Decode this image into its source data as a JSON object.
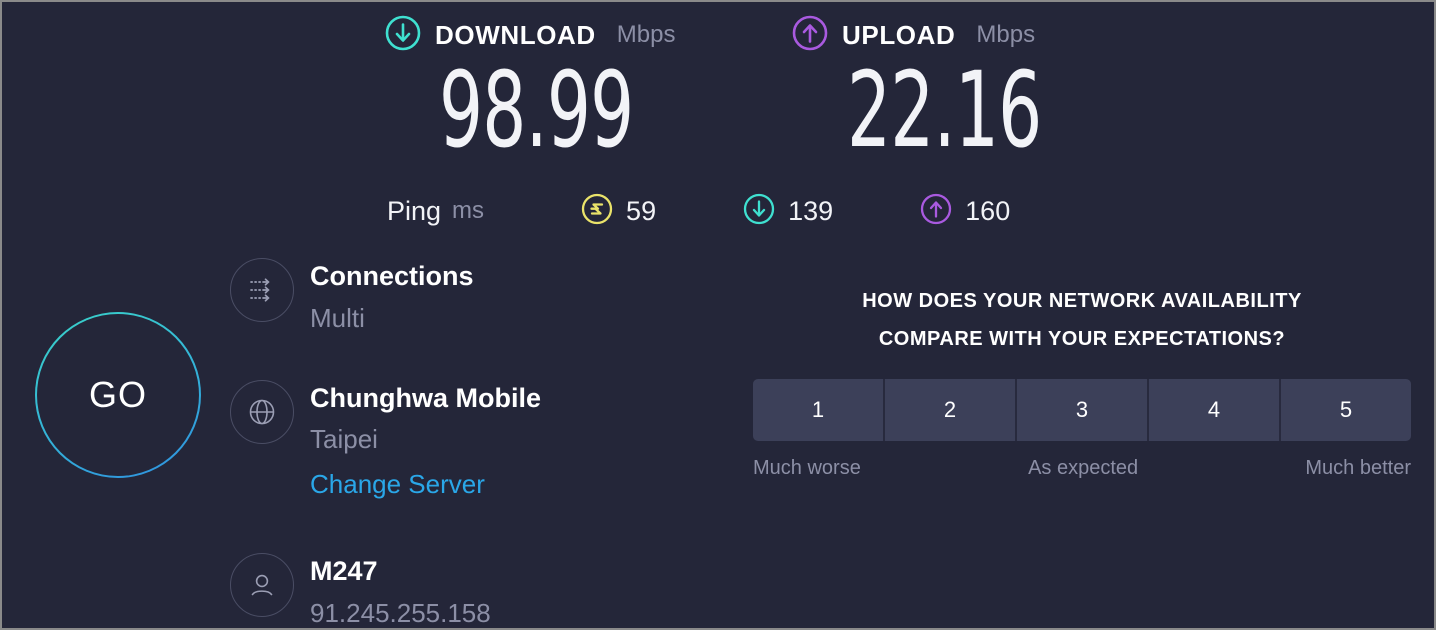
{
  "theme": {
    "background": "#242639",
    "download_accent": "#3fe0d0",
    "upload_accent": "#a95ae0",
    "idle_ping_accent": "#eae36a",
    "link_color": "#2aa7e8",
    "muted_text": "#8c8fa6",
    "rating_button_bg": "#3c4059"
  },
  "results": {
    "download": {
      "icon": "download-arrow-icon",
      "label": "DOWNLOAD",
      "unit": "Mbps",
      "value": "98.99"
    },
    "upload": {
      "icon": "upload-arrow-icon",
      "label": "UPLOAD",
      "unit": "Mbps",
      "value": "22.16"
    },
    "ping": {
      "label": "Ping",
      "unit": "ms",
      "idle": {
        "icon": "idle-ping-icon",
        "value": "59"
      },
      "download": {
        "icon": "download-ping-icon",
        "value": "139"
      },
      "upload": {
        "icon": "upload-ping-icon",
        "value": "160"
      }
    }
  },
  "go_button": {
    "label": "GO"
  },
  "connection_info": {
    "connections": {
      "icon": "multi-connections-icon",
      "title": "Connections",
      "subtitle": "Multi"
    },
    "server": {
      "icon": "globe-icon",
      "title": "Chunghwa Mobile",
      "subtitle": "Taipei",
      "change_link": "Change Server"
    },
    "isp": {
      "icon": "user-icon",
      "title": "M247",
      "subtitle": "91.245.255.158"
    }
  },
  "survey": {
    "question_line1": "HOW DOES YOUR NETWORK AVAILABILITY",
    "question_line2": "COMPARE WITH YOUR EXPECTATIONS?",
    "options": [
      "1",
      "2",
      "3",
      "4",
      "5"
    ],
    "scale_low": "Much worse",
    "scale_mid": "As expected",
    "scale_high": "Much better"
  }
}
